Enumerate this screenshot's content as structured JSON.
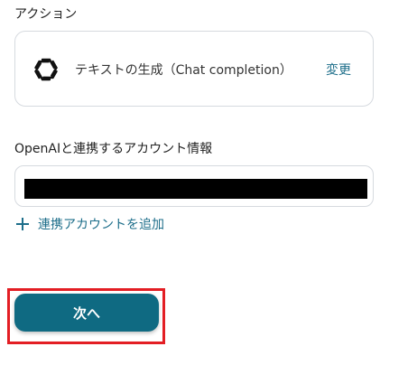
{
  "action_section": {
    "label": "アクション",
    "action_name": "テキストの生成（Chat completion）",
    "change_label": "変更",
    "icon": "openai-logo-icon"
  },
  "account_section": {
    "label": "OpenAIと連携するアカウント情報",
    "add_account_label": "連携アカウントを追加"
  },
  "footer": {
    "next_label": "次へ"
  },
  "colors": {
    "accent": "#1d6e8a",
    "button": "#0f6a82",
    "highlight": "#e31e24",
    "border": "#d6dadf"
  }
}
